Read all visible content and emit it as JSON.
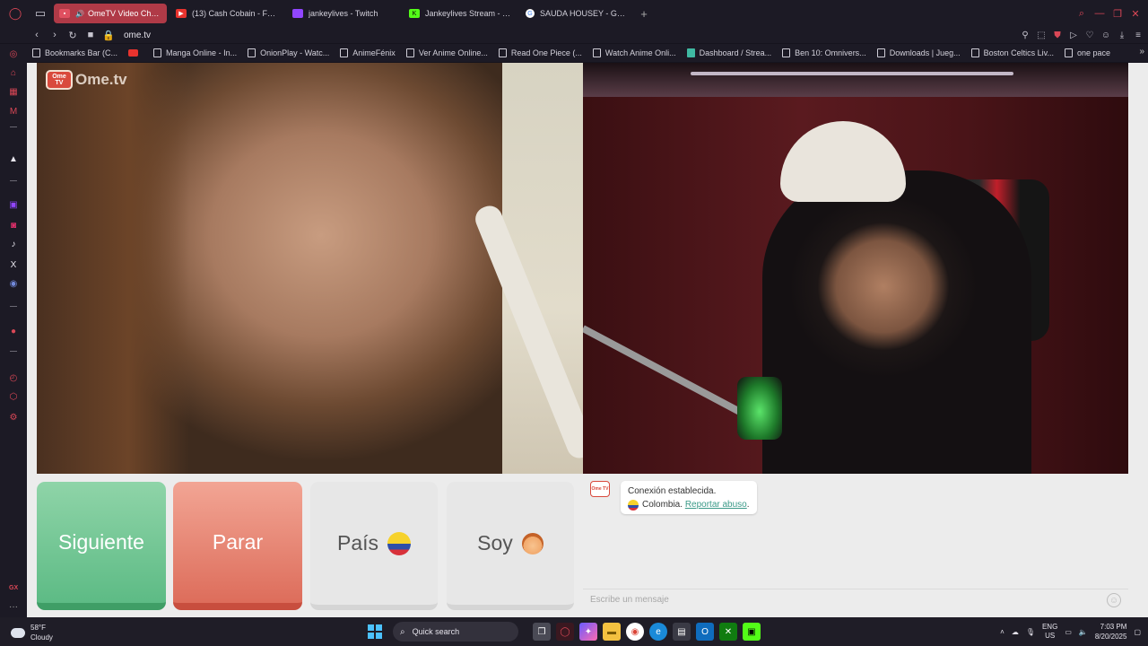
{
  "tabs": [
    {
      "title": "OmeTV Video Chat –",
      "active": true,
      "fav_color": "#e05060"
    },
    {
      "title": "(13) Cash Cobain - Feeee",
      "active": false,
      "fav_color": "#e8332e"
    },
    {
      "title": "jankeylives - Twitch",
      "active": false,
      "fav_color": "#9146ff"
    },
    {
      "title": "Jankeylives Stream - Wat",
      "active": false,
      "fav_color": "#53fc18"
    },
    {
      "title": "SAUDA HOUSEY - Google",
      "active": false,
      "fav_color": "#ffffff"
    }
  ],
  "address": {
    "url": "ome.tv"
  },
  "bookmarks": [
    {
      "label": "Bookmarks Bar (C...",
      "icon": "folder"
    },
    {
      "label": "",
      "icon": "youtube"
    },
    {
      "label": "Manga Online - In...",
      "icon": "page"
    },
    {
      "label": "OnionPlay - Watc...",
      "icon": "page"
    },
    {
      "label": "AnimeFénix",
      "icon": "page"
    },
    {
      "label": "Ver Anime Online...",
      "icon": "page"
    },
    {
      "label": "Read One Piece (...",
      "icon": "page"
    },
    {
      "label": "Watch Anime Onli...",
      "icon": "page"
    },
    {
      "label": "Dashboard / Strea...",
      "icon": "teal"
    },
    {
      "label": "Ben 10: Omnivers...",
      "icon": "page"
    },
    {
      "label": "Downloads | Jueg...",
      "icon": "page"
    },
    {
      "label": "Boston Celtics Liv...",
      "icon": "page"
    },
    {
      "label": "one pace",
      "icon": "page"
    }
  ],
  "app": {
    "logo_badge": "Ome TV",
    "logo_text": "Ome.tv",
    "buttons": {
      "next": "Siguiente",
      "stop": "Parar",
      "country": "País",
      "gender": "Soy"
    },
    "chat": {
      "badge": "Ome TV",
      "status": "Conexión establecida.",
      "country": "Colombia.",
      "report_link": "Reportar abuso",
      "period": ".",
      "input_placeholder": "Escribe un mensaje"
    }
  },
  "taskbar": {
    "temp": "58°F",
    "condition": "Cloudy",
    "search_label": "Quick search",
    "lang1": "ENG",
    "lang2": "US",
    "time": "7:03 PM",
    "date": "8/20/2025"
  },
  "colors": {
    "accent": "#d94756",
    "next_green": "#5dbb85",
    "stop_red": "#dd6d5b",
    "link": "#3b9a88"
  }
}
